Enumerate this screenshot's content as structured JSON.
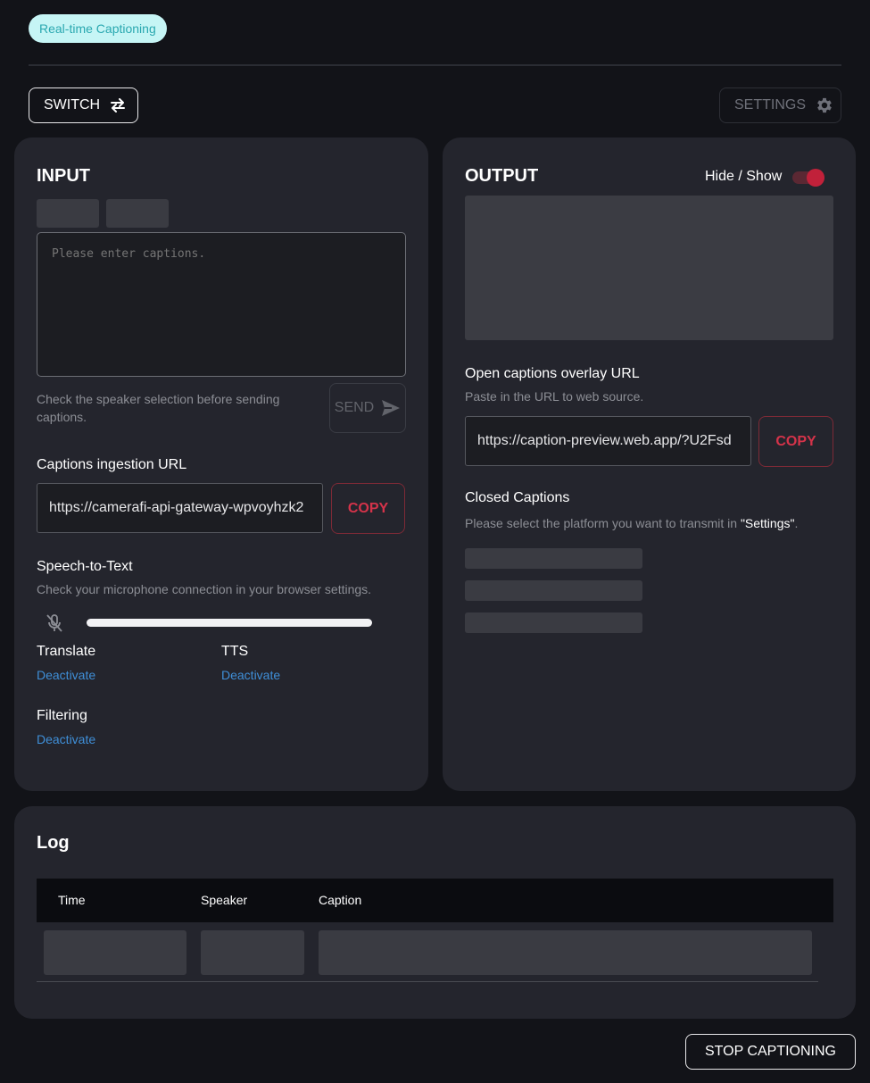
{
  "header": {
    "badge": "Real-time Captioning",
    "switch_label": "SWITCH",
    "settings_label": "SETTINGS"
  },
  "input_panel": {
    "title": "INPUT",
    "caption_placeholder": "Please enter captions.",
    "send_hint": "Check the speaker selection before sending captions.",
    "send_label": "SEND",
    "ingestion_label": "Captions ingestion URL",
    "ingestion_url": "https://camerafi-api-gateway-wpvoyhzk2",
    "copy_label": "COPY",
    "stt_title": "Speech-to-Text",
    "stt_hint": "Check your microphone connection in your browser settings.",
    "mic_level": 1.0,
    "translate_label": "Translate",
    "translate_status": "Deactivate",
    "tts_label": "TTS",
    "tts_status": "Deactivate",
    "filtering_label": "Filtering",
    "filtering_status": "Deactivate"
  },
  "output_panel": {
    "title": "OUTPUT",
    "toggle_label": "Hide / Show",
    "toggle_on": true,
    "overlay_title": "Open captions overlay URL",
    "overlay_hint": "Paste in the URL to web source.",
    "overlay_url": "https://caption-preview.web.app/?U2Fsd",
    "copy_label": "COPY",
    "cc_title": "Closed Captions",
    "cc_hint_prefix": "Please select the platform you want to transmit in ",
    "cc_hint_quote": "\"Settings\"",
    "cc_hint_suffix": "."
  },
  "log_panel": {
    "title": "Log",
    "columns": [
      "Time",
      "Speaker",
      "Caption"
    ]
  },
  "footer": {
    "stop_label": "STOP CAPTIONING"
  },
  "colors": {
    "background": "#121318",
    "card": "#24252d",
    "accent_red": "#d5334a",
    "link_blue": "#3f8fd8",
    "badge_bg": "#c6f5f5"
  }
}
